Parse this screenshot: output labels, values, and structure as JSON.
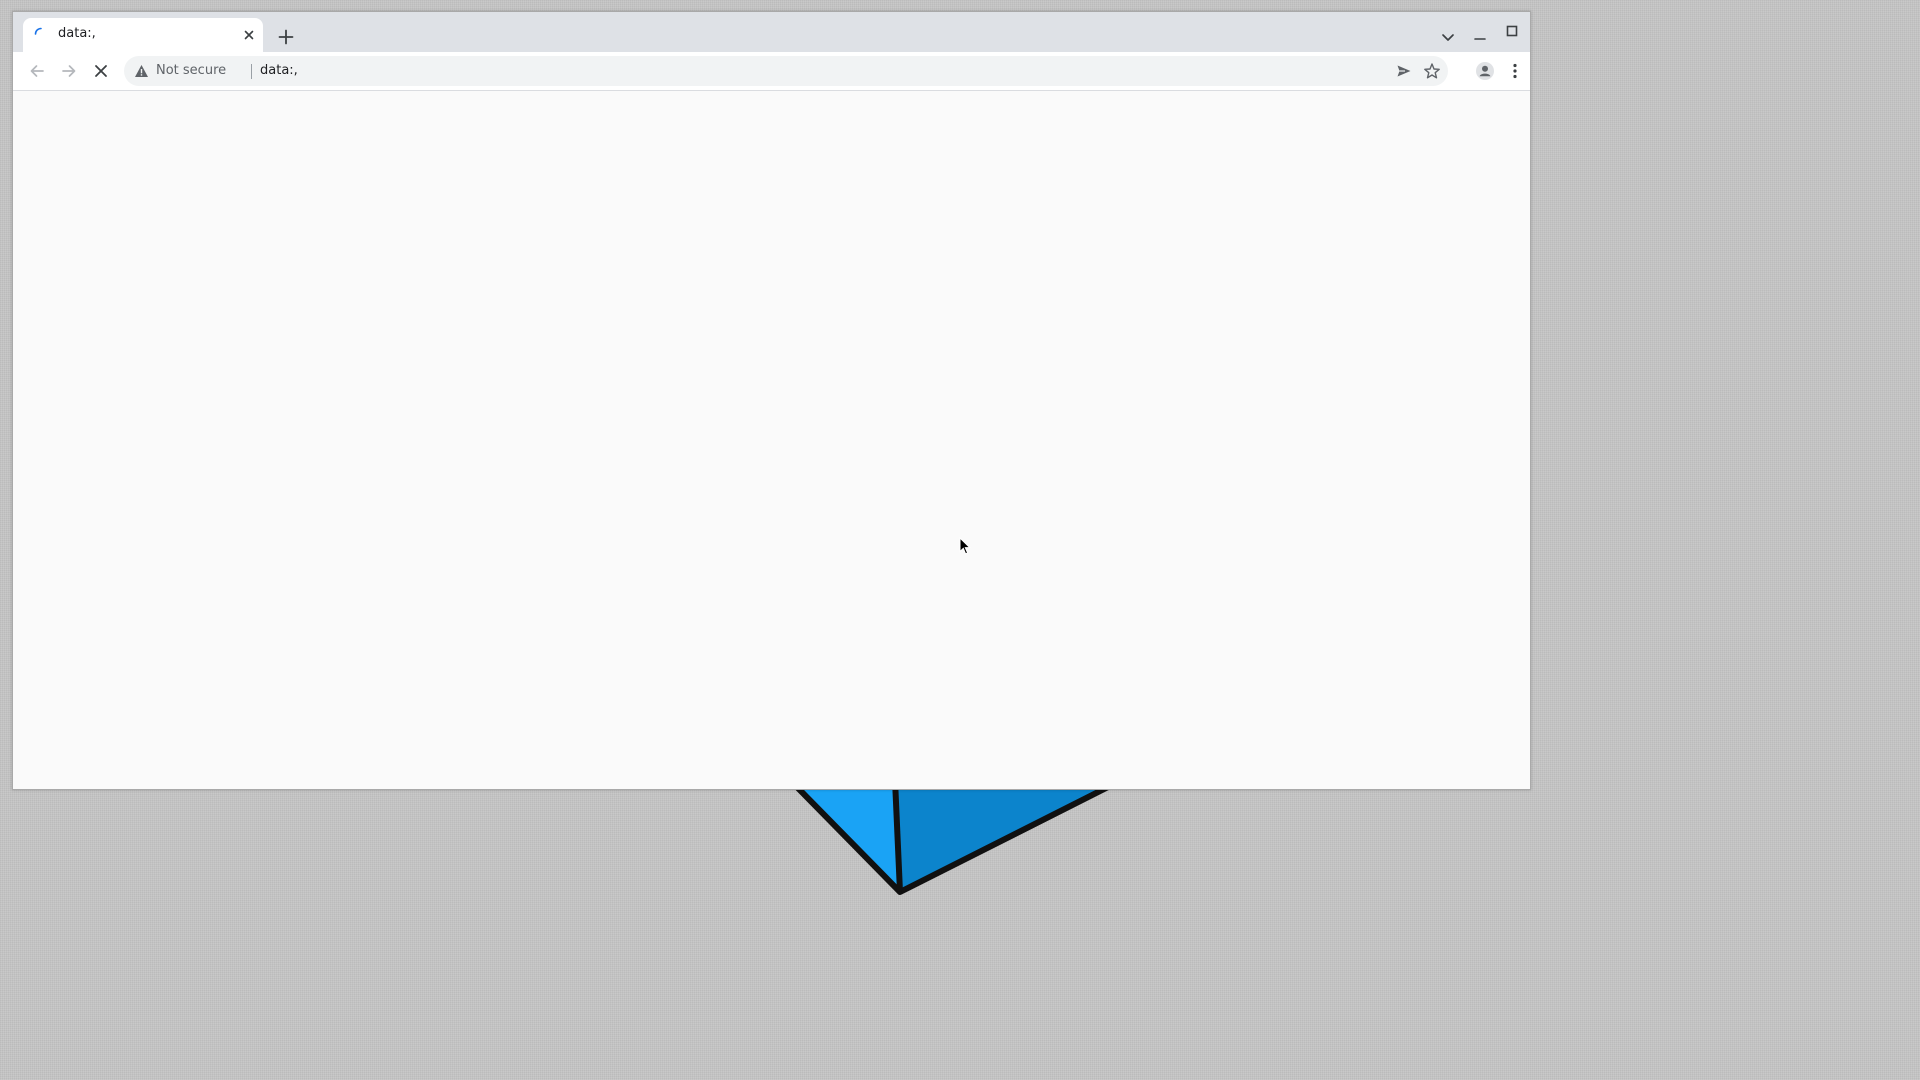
{
  "browser": {
    "tab": {
      "title": "data:,"
    },
    "toolbar": {
      "security_label": "Not secure",
      "url": "data:,"
    }
  },
  "icons": {
    "tab_loading": "loading-spinner-icon",
    "tab_close": "close-icon",
    "new_tab": "plus-icon",
    "tab_search": "chevron-down-icon",
    "minimize": "minimize-icon",
    "maximize": "maximize-icon",
    "close_window": "close-icon",
    "back": "arrow-left-icon",
    "forward": "arrow-right-icon",
    "stop": "close-icon",
    "security": "warning-icon",
    "share": "send-icon",
    "bookmark": "star-icon",
    "profile": "person-icon",
    "menu": "kebab-icon"
  },
  "colors": {
    "desktop_background": "#c3c3c3",
    "tab_strip": "#dee1e6",
    "omnibox_background": "#f1f3f4",
    "page_background": "#fafafa",
    "spinner_accent": "#1a73e8",
    "shape_left_face": "#1aa3f5",
    "shape_right_face": "#0c84cc"
  }
}
